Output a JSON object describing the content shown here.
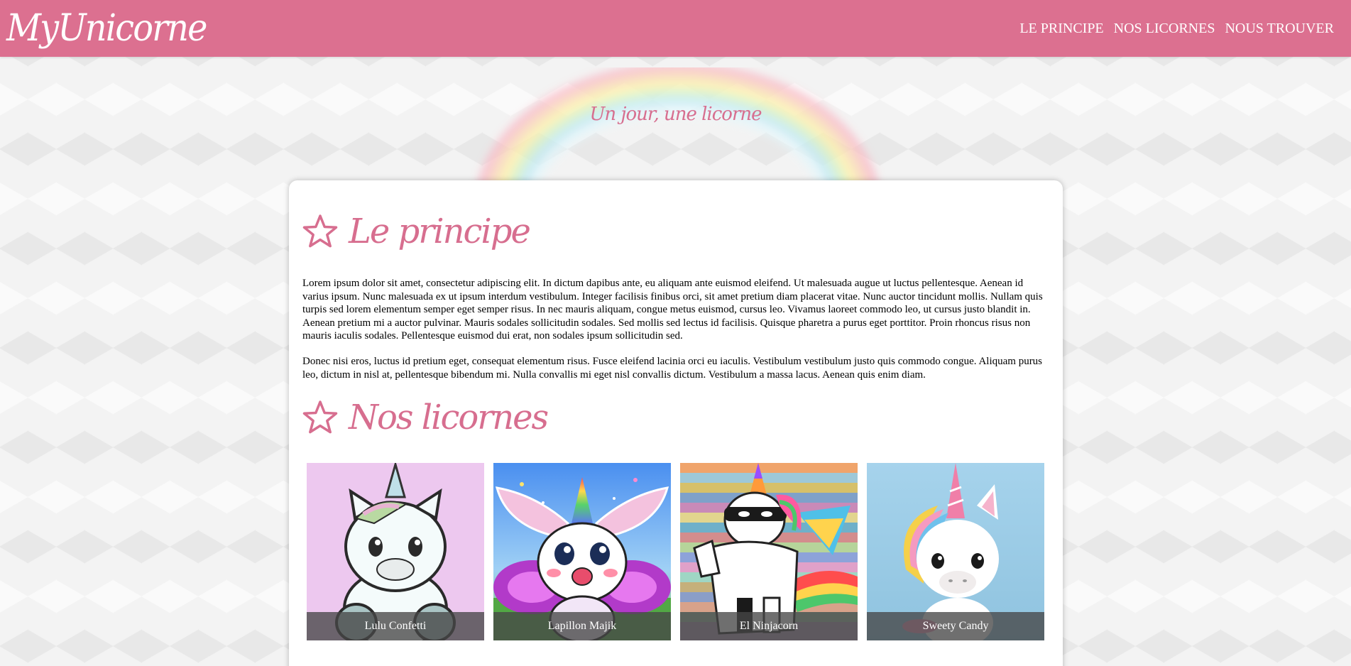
{
  "header": {
    "logo": "MyUnicorne",
    "nav": [
      {
        "label": "LE PRINCIPE"
      },
      {
        "label": "NOS LICORNES"
      },
      {
        "label": "NOUS TROUVER"
      }
    ]
  },
  "hero": {
    "tagline": "Un jour, une licorne"
  },
  "principe": {
    "title": "Le principe",
    "paragraphs": [
      "Lorem ipsum dolor sit amet, consectetur adipiscing elit. In dictum dapibus ante, eu aliquam ante euismod eleifend. Ut malesuada augue ut luctus pellentesque. Aenean id varius ipsum. Nunc malesuada ex ut ipsum interdum vestibulum. Integer facilisis finibus orci, sit amet pretium diam placerat vitae. Nunc auctor tincidunt mollis. Nullam quis turpis sed lorem elementum semper eget semper risus. In nec mauris aliquam, congue metus euismod, cursus leo. Vivamus laoreet commodo leo, ut cursus justo blandit in. Aenean pretium mi a auctor pulvinar. Mauris sodales sollicitudin sodales. Sed mollis sed lectus id facilisis. Quisque pharetra a purus eget porttitor. Proin rhoncus risus non mauris iaculis sodales. Pellentesque euismod dui erat, non sodales ipsum sollicitudin sed.",
      "Donec nisi eros, luctus id pretium eget, consequat elementum risus. Fusce eleifend lacinia orci eu iaculis. Vestibulum vestibulum justo quis commodo congue. Aliquam purus leo, dictum in nisl at, pellentesque bibendum mi. Nulla convallis mi eget nisl convallis dictum. Vestibulum a massa lacus. Aenean quis enim diam."
    ]
  },
  "licornes": {
    "title": "Nos licornes",
    "items": [
      {
        "name": "Lulu Confetti",
        "bg": "#edc8ef"
      },
      {
        "name": "Lapillon Majik",
        "bg": "#6fb4f4"
      },
      {
        "name": "El Ninjacorn",
        "bg": "#a98ca6"
      },
      {
        "name": "Sweety Candy",
        "bg": "#a7d6ec"
      }
    ]
  },
  "colors": {
    "brand_pink": "#dc7090",
    "title_pink": "#d76e8f"
  }
}
